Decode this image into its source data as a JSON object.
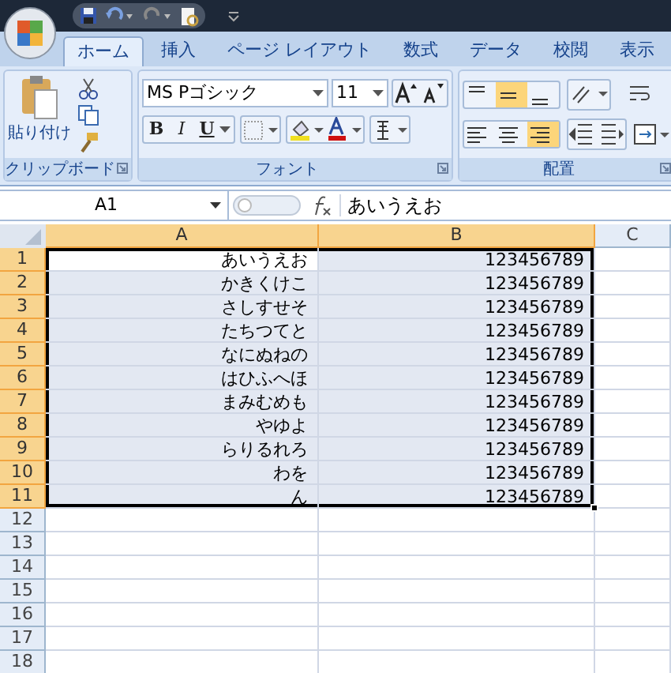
{
  "tabs": [
    {
      "label": "ホーム",
      "selected": true
    },
    {
      "label": "挿入",
      "selected": false
    },
    {
      "label": "ページ レイアウト",
      "selected": false
    },
    {
      "label": "数式",
      "selected": false
    },
    {
      "label": "データ",
      "selected": false
    },
    {
      "label": "校閲",
      "selected": false
    },
    {
      "label": "表示",
      "selected": false
    }
  ],
  "ribbon": {
    "paste_label": "貼り付け",
    "font_name": "MS Pゴシック",
    "font_size": "11",
    "groups": [
      {
        "label": "クリップボード"
      },
      {
        "label": "フォント"
      },
      {
        "label": "配置"
      }
    ],
    "style_buttons": [
      {
        "kind": "bold",
        "label": "B"
      },
      {
        "kind": "italic",
        "label": "I"
      },
      {
        "kind": "underline",
        "label": "U"
      }
    ],
    "vertical_align": [
      {
        "kind": "top",
        "selected": false
      },
      {
        "kind": "middle",
        "selected": true
      },
      {
        "kind": "bottom",
        "selected": false
      }
    ],
    "horizontal_align": [
      {
        "kind": "left",
        "selected": false
      },
      {
        "kind": "center",
        "selected": false
      },
      {
        "kind": "right",
        "selected": true
      }
    ]
  },
  "formula_bar": {
    "name_box": "A1",
    "content": "あいうえお"
  },
  "sheet": {
    "columns": [
      {
        "label": "A",
        "selected": true
      },
      {
        "label": "B",
        "selected": true
      },
      {
        "label": "C",
        "selected": false
      }
    ],
    "rows": [
      {
        "label": "1",
        "selected": true,
        "cells": [
          {
            "text": "あいうえお",
            "selected": true,
            "active": true
          },
          {
            "text": "123456789",
            "selected": true,
            "active": false
          }
        ]
      },
      {
        "label": "2",
        "selected": true,
        "cells": [
          {
            "text": "かきくけこ",
            "selected": true,
            "active": false
          },
          {
            "text": "123456789",
            "selected": true,
            "active": false
          }
        ]
      },
      {
        "label": "3",
        "selected": true,
        "cells": [
          {
            "text": "さしすせそ",
            "selected": true,
            "active": false
          },
          {
            "text": "123456789",
            "selected": true,
            "active": false
          }
        ]
      },
      {
        "label": "4",
        "selected": true,
        "cells": [
          {
            "text": "たちつてと",
            "selected": true,
            "active": false
          },
          {
            "text": "123456789",
            "selected": true,
            "active": false
          }
        ]
      },
      {
        "label": "5",
        "selected": true,
        "cells": [
          {
            "text": "なにぬねの",
            "selected": true,
            "active": false
          },
          {
            "text": "123456789",
            "selected": true,
            "active": false
          }
        ]
      },
      {
        "label": "6",
        "selected": true,
        "cells": [
          {
            "text": "はひふへほ",
            "selected": true,
            "active": false
          },
          {
            "text": "123456789",
            "selected": true,
            "active": false
          }
        ]
      },
      {
        "label": "7",
        "selected": true,
        "cells": [
          {
            "text": "まみむめも",
            "selected": true,
            "active": false
          },
          {
            "text": "123456789",
            "selected": true,
            "active": false
          }
        ]
      },
      {
        "label": "8",
        "selected": true,
        "cells": [
          {
            "text": "やゆよ",
            "selected": true,
            "active": false
          },
          {
            "text": "123456789",
            "selected": true,
            "active": false
          }
        ]
      },
      {
        "label": "9",
        "selected": true,
        "cells": [
          {
            "text": "らりるれろ",
            "selected": true,
            "active": false
          },
          {
            "text": "123456789",
            "selected": true,
            "active": false
          }
        ]
      },
      {
        "label": "10",
        "selected": true,
        "cells": [
          {
            "text": "わを",
            "selected": true,
            "active": false
          },
          {
            "text": "123456789",
            "selected": true,
            "active": false
          }
        ]
      },
      {
        "label": "11",
        "selected": true,
        "cells": [
          {
            "text": "ん",
            "selected": true,
            "active": false
          },
          {
            "text": "123456789",
            "selected": true,
            "active": false
          }
        ]
      },
      {
        "label": "12",
        "selected": false
      },
      {
        "label": "13",
        "selected": false
      },
      {
        "label": "14",
        "selected": false
      },
      {
        "label": "15",
        "selected": false
      },
      {
        "label": "16",
        "selected": false
      },
      {
        "label": "17",
        "selected": false
      },
      {
        "label": "18",
        "selected": false
      }
    ]
  }
}
